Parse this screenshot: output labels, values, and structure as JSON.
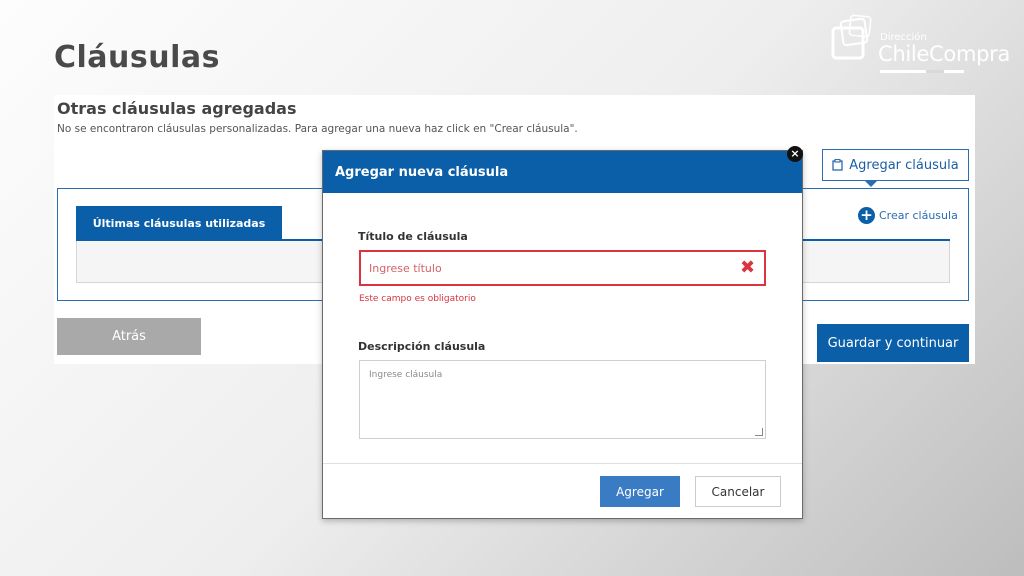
{
  "slide": {
    "title": "Cláusulas"
  },
  "logo": {
    "small_text": "Dirección",
    "big_text": "ChileCompra"
  },
  "page": {
    "section_heading": "Otras cláusulas agregadas",
    "section_description": "No se encontraron cláusulas personalizadas. Para agregar una nueva haz click en \"Crear cláusula\".",
    "add_clause_button": "Agregar cláusula",
    "add_clause_icon": "clipboard-icon",
    "active_tab": "Últimas cláusulas utilizadas",
    "create_clause_link": "Crear cláusula",
    "create_clause_icon": "plus-circle-icon",
    "back_button": "Atrás",
    "save_button": "Guardar y continuar"
  },
  "modal": {
    "title": "Agregar nueva cláusula",
    "close_icon": "close-icon",
    "title_field": {
      "label": "Título de cláusula",
      "value": "",
      "placeholder": "Ingrese título",
      "error": "Este campo es obligatorio",
      "error_icon": "error-x-icon"
    },
    "description_field": {
      "label": "Descripción cláusula",
      "value": "",
      "placeholder": "Ingrese cláusula"
    },
    "add_button": "Agregar",
    "cancel_button": "Cancelar"
  },
  "colors": {
    "primary": "#0a5fa8",
    "error": "#d9343f",
    "secondary_button": "#a9a9a9"
  }
}
